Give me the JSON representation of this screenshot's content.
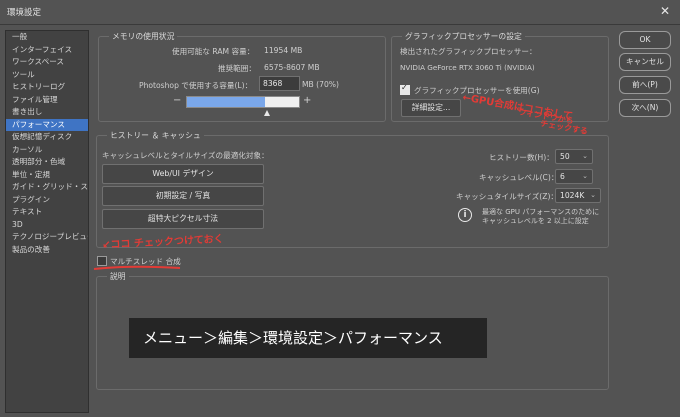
{
  "window": {
    "title": "環境設定",
    "close_symbol": "✕"
  },
  "sidebar": {
    "items": [
      {
        "label": "一般"
      },
      {
        "label": "インターフェイス"
      },
      {
        "label": "ワークスペース"
      },
      {
        "label": "ツール"
      },
      {
        "label": "ヒストリーログ"
      },
      {
        "label": "ファイル管理"
      },
      {
        "label": "書き出し"
      },
      {
        "label": "パフォーマンス",
        "active": true
      },
      {
        "label": "仮想記憶ディスク"
      },
      {
        "label": "カーソル"
      },
      {
        "label": "透明部分・色域"
      },
      {
        "label": "単位・定規"
      },
      {
        "label": "ガイド・グリッド・スライス"
      },
      {
        "label": "プラグイン"
      },
      {
        "label": "テキスト"
      },
      {
        "label": "3D"
      },
      {
        "label": "テクノロジープレビュー"
      },
      {
        "label": "製品の改善"
      }
    ]
  },
  "memory": {
    "legend": "メモリの使用状況",
    "available_label": "使用可能な RAM 容量：",
    "available_value": "11954 MB",
    "range_label": "推奨範囲：",
    "range_value": "6575-8607 MB",
    "use_label": "Photoshop で使用する容量(L)：",
    "use_value": "8368",
    "use_suffix": "MB (70%)",
    "minus": "−",
    "plus": "+",
    "usage_fraction": 0.7
  },
  "gpu": {
    "legend": "グラフィックプロセッサーの設定",
    "detected_label": "検出されたグラフィックプロセッサー：",
    "detected_value": "NVIDIA GeForce RTX 3060 Ti (NVIDIA)",
    "use_gpu_label": "グラフィックプロセッサーを使用(G)",
    "use_gpu_checked": true,
    "advanced_button": "詳細設定..."
  },
  "history_cache": {
    "legend": "ヒストリー ＆ キャッシュ",
    "optimize_label": "キャッシュレベルとタイルサイズの最適化対象：",
    "buttons": [
      {
        "label": "Web/UI デザイン"
      },
      {
        "label": "初期設定 / 写真"
      },
      {
        "label": "超特大ピクセル寸法"
      }
    ],
    "history_states_label": "ヒストリー数(H)：",
    "history_states_value": "50",
    "cache_levels_label": "キャッシュレベル(C)：",
    "cache_levels_value": "6",
    "cache_tile_label": "キャッシュタイルサイズ(Z)：",
    "cache_tile_value": "1024K",
    "info_icon": "i",
    "info_text_1": "最適な GPU パフォーマンスのために",
    "info_text_2": "キャッシュレベルを 2 以上に設定"
  },
  "multithread": {
    "label": "マルチスレッド 合成",
    "checked": false
  },
  "description": {
    "legend": "説明"
  },
  "right_buttons": {
    "ok": "OK",
    "cancel": "キャンセル",
    "prev": "前へ(P)",
    "next": "次へ(N)"
  },
  "annotations": {
    "gpu_note": "←GPU合成はココおして",
    "gpu_note_2": "ウィンドウから",
    "gpu_note_3": "チェックする",
    "multithread_note": "↙ココ チェックつけておく"
  },
  "banner": {
    "text": "メニュー＞編集＞環境設定＞パフォーマンス"
  }
}
